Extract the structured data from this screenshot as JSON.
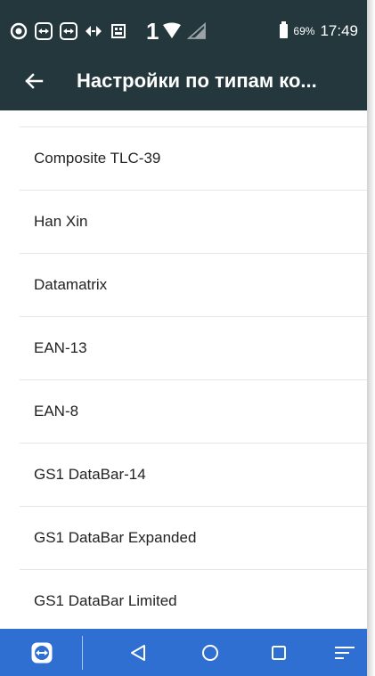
{
  "status_bar": {
    "sim_label": "1",
    "battery_percent": "69%",
    "time": "17:49",
    "icons": [
      "record-icon",
      "teamviewer-icon",
      "teamviewer-icon",
      "tunnel-icon",
      "sim-card-icon",
      "signal-icon",
      "no-signal-icon",
      "battery-icon"
    ]
  },
  "app_bar": {
    "back_icon": "arrow-left-icon",
    "title": "Настройки по типам ко..."
  },
  "list": {
    "items": [
      {
        "label": "Composite TLC-39"
      },
      {
        "label": "Han Xin"
      },
      {
        "label": "Datamatrix"
      },
      {
        "label": "EAN-13"
      },
      {
        "label": "EAN-8"
      },
      {
        "label": "GS1 DataBar-14"
      },
      {
        "label": "GS1 DataBar Expanded"
      },
      {
        "label": "GS1 DataBar Limited"
      }
    ]
  },
  "nav_bar": {
    "icons": [
      "teamviewer-icon",
      "back-triangle-icon",
      "home-circle-icon",
      "recents-square-icon",
      "menu-lines-icon"
    ]
  },
  "colors": {
    "app_bar": "#23373d",
    "nav_bar": "#2f6fd1",
    "divider": "#e6e6e6",
    "text": "#222222"
  }
}
